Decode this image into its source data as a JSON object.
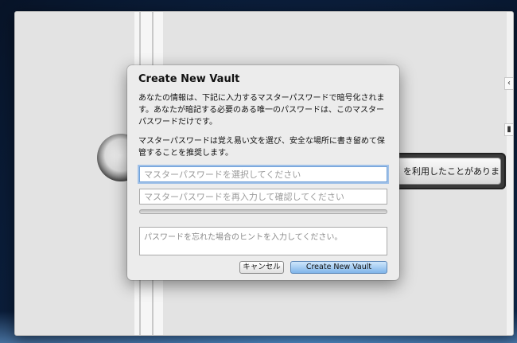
{
  "dialog": {
    "title": "Create New Vault",
    "info_text": "あなたの情報は、下記に入力するマスターパスワードで暗号化されます。あなたが暗記する必要のある唯一のパスワードは、このマスターパスワードだけです。",
    "recommend_text": "マスターパスワードは覚え易い文を選び、安全な場所に書き留めて保管することを推奨します。",
    "password_placeholder": "マスターパスワードを選択してください",
    "confirm_placeholder": "マスターパスワードを再入力して確認してください",
    "hint_placeholder": "パスワードを忘れた場合のヒントを入力してください。",
    "cancel_label": "キャンセル",
    "create_label": "Create New Vault"
  },
  "background": {
    "unlock_button_label": "を利用したことがあります"
  },
  "colors": {
    "primary_button": "#7fb5ea",
    "focus_ring": "#6fa0d8",
    "dialog_bg": "#ececec"
  }
}
